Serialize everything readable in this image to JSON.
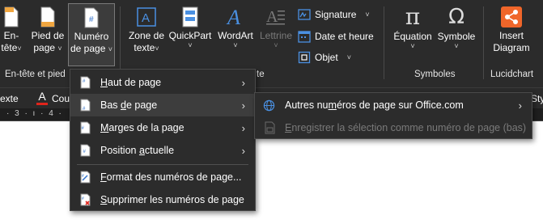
{
  "ribbon": {
    "entete": {
      "line1": "En-",
      "line2": "tête"
    },
    "pied": {
      "line1": "Pied de",
      "line2": "page"
    },
    "numero": {
      "line1": "Numéro",
      "line2": "de page"
    },
    "zone": {
      "line1": "Zone de",
      "line2": "texte"
    },
    "quickpart": {
      "line1": "QuickPart"
    },
    "wordart": {
      "line1": "WordArt"
    },
    "lettrine": {
      "line1": "Lettrine"
    },
    "signature": "Signature",
    "dateheure": "Date et heure",
    "objet": "Objet",
    "equation": "Équation",
    "symbole": "Symbole",
    "insert": {
      "line1": "Insert",
      "line2": "Diagram"
    },
    "equation_glyph": "π",
    "symbole_glyph": "Ω",
    "groups": {
      "entete_pied": "En-tête et pied",
      "texte_tail": "te",
      "symboles": "Symboles",
      "lucidchart": "Lucidchart"
    }
  },
  "fmtbar": {
    "left_text": "exte",
    "font_color_letter": "A",
    "font_color_trunc": "Cou",
    "right_trunc": "Sty"
  },
  "ruler": {
    "marks": "· 3 · ı · 4 ·"
  },
  "menu": {
    "items": [
      {
        "pre": "",
        "ul": "H",
        "post": "aut de page",
        "arrow": "›"
      },
      {
        "pre": "Bas ",
        "ul": "d",
        "post": "e page",
        "arrow": "›"
      },
      {
        "pre": "",
        "ul": "M",
        "post": "arges de la page",
        "arrow": "›"
      },
      {
        "pre": "Position ",
        "ul": "a",
        "post": "ctuelle",
        "arrow": "›"
      },
      {
        "pre": "",
        "ul": "F",
        "post": "ormat des numéros de page...",
        "arrow": ""
      },
      {
        "pre": "",
        "ul": "S",
        "post": "upprimer les numéros de page",
        "arrow": ""
      }
    ]
  },
  "submenu": {
    "items": [
      {
        "pre": "Autres nu",
        "ul": "m",
        "post": "éros de page sur Office.com",
        "arrow": "›"
      },
      {
        "pre": "",
        "ul": "E",
        "post": "nregistrer la sélection comme numéro de page (bas)",
        "arrow": ""
      }
    ]
  },
  "colors": {
    "ribbon_bg": "#2b2b2b",
    "menu_bg": "#2c2c2c",
    "highlight": "#3d3d3d",
    "accent_blue": "#4a90e2",
    "lucid_orange": "#f0662a",
    "font_red": "#e0241b"
  }
}
